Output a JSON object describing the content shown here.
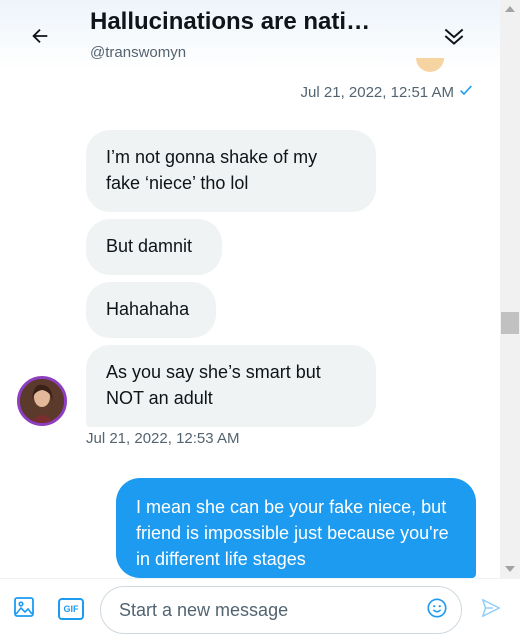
{
  "header": {
    "title": "Hallucinations are nati…",
    "handle": "@transwomyn",
    "back_icon": "arrow-left-icon",
    "collapse_icon": "double-chevron-down-icon"
  },
  "messages": {
    "sent_timestamp": "Jul 21, 2022, 12:51 AM",
    "received": [
      "I’m not gonna shake of my fake ‘niece’ tho lol",
      "But damnit",
      "Hahahaha",
      "As you say she’s smart but NOT an adult"
    ],
    "received_timestamp": "Jul 21, 2022, 12:53 AM",
    "outgoing": "I mean she can be your fake niece, but friend is impossible just because you're in different life stages"
  },
  "composer": {
    "placeholder": "Start a new message",
    "gif_label": "GIF",
    "media_icon": "image-icon",
    "emoji_icon": "emoji-icon",
    "send_icon": "send-icon"
  },
  "colors": {
    "accent": "#1d9bf0",
    "received_bubble": "#eff3f4",
    "text_primary": "#0f1419",
    "text_secondary": "#536471"
  }
}
